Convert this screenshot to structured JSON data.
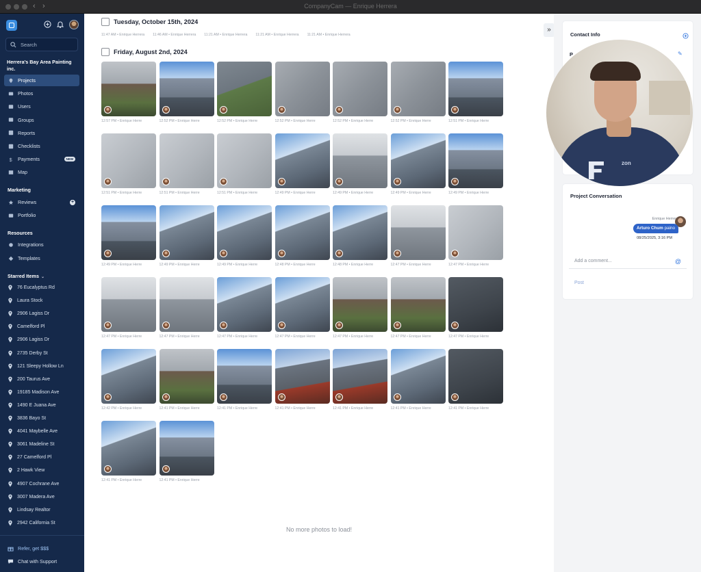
{
  "window": {
    "title": "CompanyCam — Enrique Herrera"
  },
  "sidebar": {
    "search_placeholder": "Search",
    "company": "Herrera's Bay Area Painting inc.",
    "nav": [
      {
        "label": "Projects",
        "icon": "pin-icon",
        "active": true
      },
      {
        "label": "Photos",
        "icon": "photo-icon"
      },
      {
        "label": "Users",
        "icon": "users-icon"
      },
      {
        "label": "Groups",
        "icon": "groups-icon"
      },
      {
        "label": "Reports",
        "icon": "reports-icon"
      },
      {
        "label": "Checklists",
        "icon": "checklist-icon"
      },
      {
        "label": "Payments",
        "icon": "dollar-icon",
        "badge": "NEW"
      },
      {
        "label": "Map",
        "icon": "map-icon"
      }
    ],
    "marketing_label": "Marketing",
    "marketing": [
      {
        "label": "Reviews",
        "icon": "star-icon"
      },
      {
        "label": "Portfolio",
        "icon": "portfolio-icon"
      }
    ],
    "resources_label": "Resources",
    "resources": [
      {
        "label": "Integrations",
        "icon": "integrations-icon"
      },
      {
        "label": "Templates",
        "icon": "templates-icon"
      }
    ],
    "starred_label": "Starred Items",
    "starred": [
      "76 Eucalyptus Rd",
      "Laura Stock",
      "2906 Lagiss Dr",
      "Camelford Pl",
      "2906 Lagiss Dr",
      "2735 Derby St",
      "121 Sleepy Hollow Ln",
      "200 Taurus Ave",
      "19185 Madison Ave",
      "1490 E Juana Ave",
      "3836 Bayo St",
      "4041 Maybelle Ave",
      "3061 Madeline St",
      "27 Camelford Pl",
      "2 Hawk View",
      "4907 Cochrane Ave",
      "3007 Madera Ave",
      "Lindsay Realtor",
      "2942 California St"
    ],
    "refer": "Refer, get $$$",
    "support": "Chat with Support"
  },
  "main": {
    "date1": "Tuesday, October 15th, 2024",
    "date1_caps": [
      "11:47 AM • Enrique Herrera",
      "11:46 AM • Enrique Herrera",
      "11:21 AM • Enrique Herrera",
      "11:21 AM • Enrique Herrera",
      "11:21 AM • Enrique Herrera"
    ],
    "date2": "Friday, August 2nd, 2024",
    "rows": [
      {
        "caps": [
          "12:57 PM • Enrique Herre",
          "12:52 PM • Enrique Herre",
          "12:52 PM • Enrique Herre",
          "12:52 PM • Enrique Herre",
          "12:52 PM • Enrique Herre",
          "12:52 PM • Enrique Herre",
          "12:51 PM • Enrique Herre"
        ],
        "styles": [
          "t-porch",
          "t-house",
          "t-garden",
          "t-wall",
          "t-wall",
          "t-wall",
          "t-house"
        ]
      },
      {
        "caps": [
          "12:51 PM • Enrique Herre",
          "12:51 PM • Enrique Herre",
          "12:51 PM • Enrique Herre",
          "12:49 PM • Enrique Herre",
          "12:49 PM • Enrique Herre",
          "12:49 PM • Enrique Herre",
          "12:49 PM • Enrique Herre"
        ],
        "styles": [
          "t-wallL",
          "t-wallL",
          "t-wallL",
          "t-sky",
          "t-eave",
          "t-sky",
          "t-house"
        ]
      },
      {
        "caps": [
          "12:49 PM • Enrique Herre",
          "12:49 PM • Enrique Herre",
          "12:49 PM • Enrique Herre",
          "12:48 PM • Enrique Herre",
          "12:48 PM • Enrique Herre",
          "12:47 PM • Enrique Herre",
          "12:47 PM • Enrique Herre"
        ],
        "styles": [
          "t-house",
          "t-sky",
          "t-sky",
          "t-sky",
          "t-sky",
          "t-eave",
          "t-wallL"
        ]
      },
      {
        "caps": [
          "12:47 PM • Enrique Herre",
          "12:47 PM • Enrique Herre",
          "12:47 PM • Enrique Herre",
          "12:47 PM • Enrique Herre",
          "12:47 PM • Enrique Herre",
          "12:47 PM • Enrique Herre",
          "12:47 PM • Enrique Herre"
        ],
        "styles": [
          "t-eave",
          "t-eave",
          "t-sky",
          "t-sky",
          "t-porch",
          "t-porch",
          "t-dark"
        ]
      },
      {
        "caps": [
          "12:42 PM • Enrique Herre",
          "12:41 PM • Enrique Herre",
          "12:41 PM • Enrique Herre",
          "12:41 PM • Enrique Herre",
          "12:41 PM • Enrique Herre",
          "12:41 PM • Enrique Herre",
          "12:41 PM • Enrique Herre"
        ],
        "styles": [
          "t-sky",
          "t-porch",
          "t-house",
          "t-red",
          "t-red",
          "t-sky",
          "t-dark"
        ]
      },
      {
        "caps": [
          "12:41 PM • Enrique Herre",
          "12:41 PM • Enrique Herre"
        ],
        "styles": [
          "t-sky",
          "t-house"
        ]
      }
    ],
    "no_more": "No more photos to load!"
  },
  "right": {
    "contact_title": "Contact Info",
    "cut_label": "P",
    "conversation_title": "Project Conversation",
    "sender": "Enrique Herrera",
    "mention": "Arturo Chum",
    "message_rest": " paino",
    "msg_time": "08/25/2025, 3:16 PM",
    "comment_placeholder": "Add a comment...",
    "post_label": "Post"
  },
  "webcam": {
    "shirt_text": "zon"
  }
}
